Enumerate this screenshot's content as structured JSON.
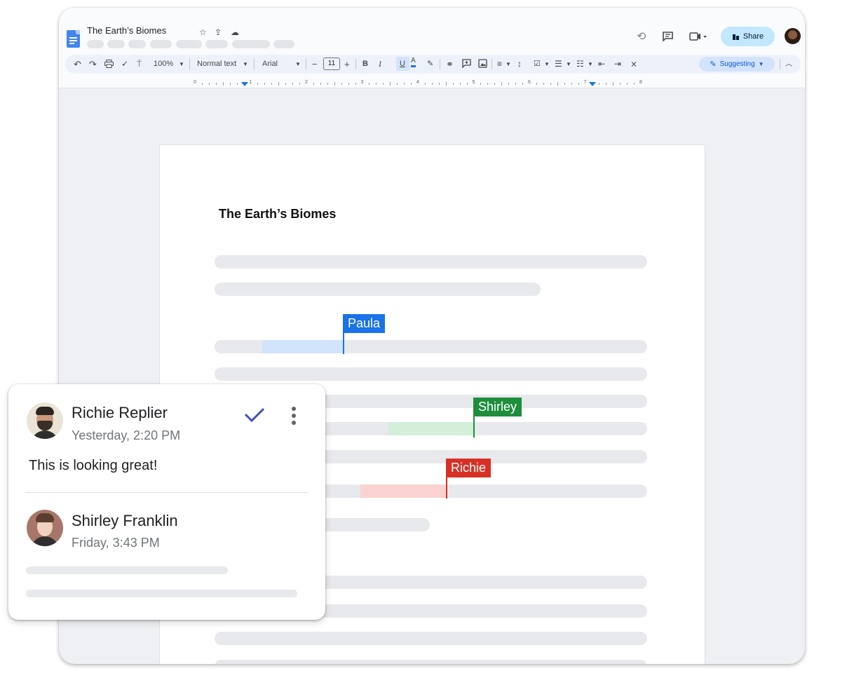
{
  "app": {
    "doc_title": "The Earth’s Biomes"
  },
  "toolbar": {
    "zoom": "100%",
    "style": "Normal text",
    "font": "Arial",
    "font_size": "11",
    "bold": "B",
    "italic": "I",
    "underline": "U",
    "text_color": "A",
    "mode": "Suggesting"
  },
  "header": {
    "share_label": "Share"
  },
  "ruler": {
    "numbers": [
      "0",
      "1",
      "2",
      "3",
      "4",
      "5",
      "6",
      "7",
      "8"
    ]
  },
  "document": {
    "heading": "The Earth’s Biomes"
  },
  "collaborators": [
    {
      "name": "Paula",
      "color": "#1a73e8",
      "highlight": "#d2e3fc"
    },
    {
      "name": "Shirley",
      "color": "#1e8e3e",
      "highlight": "#d3efda"
    },
    {
      "name": "Richie",
      "color": "#d93025",
      "highlight": "#fad2cf"
    }
  ],
  "comments": [
    {
      "author": "Richie Replier",
      "time": "Yesterday, 2:20 PM",
      "text": "This is looking great!"
    },
    {
      "author": "Shirley Franklin",
      "time": "Friday, 3:43 PM"
    }
  ],
  "icons": [
    "docs-icon",
    "star-icon",
    "move-to-drive-icon",
    "cloud-saved-icon",
    "history-icon",
    "comment-icon",
    "meet-icon",
    "share-lock-icon",
    "undo-icon",
    "redo-icon",
    "print-icon",
    "spellcheck-icon",
    "paint-format-icon",
    "link-icon",
    "add-comment-icon",
    "image-icon",
    "align-icon",
    "line-spacing-icon",
    "checklist-icon",
    "bulleted-list-icon",
    "numbered-list-icon",
    "indent-decrease-icon",
    "indent-increase-icon",
    "clear-format-icon",
    "collapse-icon",
    "resolve-check-icon",
    "more-vert-icon"
  ]
}
